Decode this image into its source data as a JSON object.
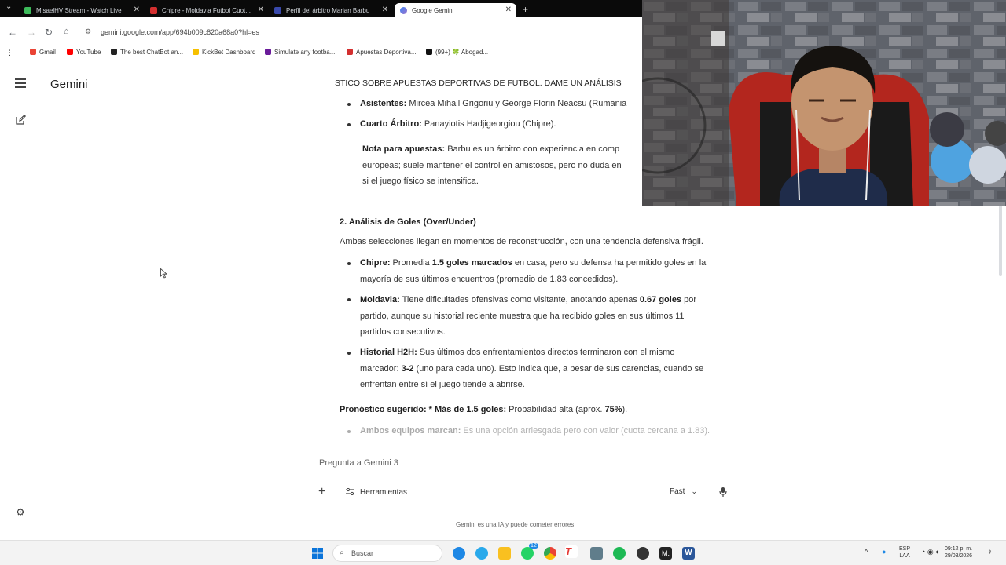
{
  "browser": {
    "tabs": [
      {
        "title": "MisaelHV Stream - Watch Live",
        "active": false
      },
      {
        "title": "Chipre - Moldavia Futbol Cuot...",
        "active": false
      },
      {
        "title": "Perfil del árbitro Marian Barbu",
        "active": false
      },
      {
        "title": "Google Gemini",
        "active": true
      }
    ],
    "new_tab": "+",
    "url": "gemini.google.com/app/694b009c820a68a0?hl=es",
    "bookmarks": [
      "Gmail",
      "YouTube",
      "The best ChatBot an...",
      "KickBet Dashboard",
      "Simulate any footba...",
      "Apuestas Deportiva...",
      "(99+) 🍀 Abogad..."
    ]
  },
  "sidebar": {
    "app_title": "Gemini"
  },
  "conversation": {
    "user_query": "STICO SOBRE APUESTAS DEPORTIVAS DE FUTBOL. DAME UN ANÁLISIS",
    "assistants_label": "Asistentes:",
    "assistants_text": " Mircea Mihail Grigoriu y George Florin Neacsu (Rumania",
    "fourth_label": "Cuarto Árbitro:",
    "fourth_text": " Panayiotis Hadjigeorgiou (Chipre).",
    "note_label": "Nota para apuestas:",
    "note_line1": " Barbu es un árbitro con experiencia en comp",
    "note_line2": "europeas; suele mantener el control en amistosos, pero no duda en",
    "note_line3": "si el juego físico se intensifica.",
    "section_heading": "2. Análisis de Goles (Over/Under)",
    "intro": "Ambas selecciones llegan en momentos de reconstrucción, con una tendencia defensiva frágil.",
    "chipre_label": "Chipre:",
    "chipre_pre": " Promedia ",
    "chipre_bold": "1.5 goles marcados",
    "chipre_post": " en casa, pero su defensa ha permitido goles en la",
    "chipre_line2": "mayoría de sus últimos encuentros (promedio de 1.83 concedidos).",
    "moldavia_label": "Moldavia:",
    "moldavia_pre": " Tiene dificultades ofensivas como visitante, anotando apenas ",
    "moldavia_bold": "0.67 goles",
    "moldavia_post": " por",
    "moldavia_line2": "partido, aunque su historial reciente muestra que ha recibido goles en sus últimos 11",
    "moldavia_line3": "partidos consecutivos.",
    "h2h_label": "Historial H2H:",
    "h2h_text": " Sus últimos dos enfrentamientos directos terminaron con el mismo",
    "h2h_line2_pre": "marcador: ",
    "h2h_bold": "3-2",
    "h2h_line2_post": " (uno para cada uno). Esto indica que, a pesar de sus carencias, cuando se",
    "h2h_line3": "enfrentan entre sí el juego tiende a abrirse.",
    "forecast_label": "Pronóstico sugerido:",
    "forecast_mid": " * Más de 1.5 goles:",
    "forecast_text": " Probabilidad alta (aprox. ",
    "forecast_pct": "75%",
    "forecast_end": ").",
    "both_label": "Ambos equipos marcan:",
    "both_text": " Es una opción arriesgada pero con valor (cuota cercana a 1.83)."
  },
  "input": {
    "placeholder": "Pregunta a Gemini 3",
    "add": "+",
    "tools_label": "Herramientas",
    "mode_label": "Fast",
    "disclaimer": "Gemini es una IA y puede cometer errores."
  },
  "taskbar": {
    "search_placeholder": "Buscar",
    "whatsapp_badge": "12",
    "lang_line1": "ESP",
    "lang_line2": "LAA",
    "time": "09:12 p. m.",
    "date": "29/03/2026"
  },
  "colors": {
    "accent": "#1a73e8",
    "tab_bar": "#0a0a0a",
    "text": "#1f1f1f"
  }
}
